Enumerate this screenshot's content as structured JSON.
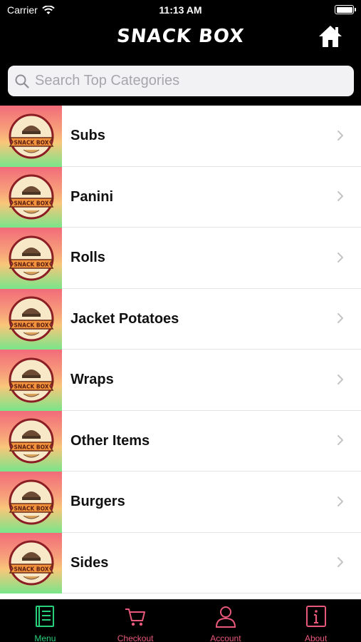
{
  "status": {
    "carrier": "Carrier",
    "time": "11:13 AM"
  },
  "header": {
    "title": "SNACK BOX",
    "home_icon": "home-icon"
  },
  "search": {
    "placeholder": "Search Top Categories",
    "value": ""
  },
  "categories": [
    {
      "label": "Subs",
      "logo_text": "SNACK BOX"
    },
    {
      "label": "Panini",
      "logo_text": "SNACK BOX"
    },
    {
      "label": "Rolls",
      "logo_text": "SNACK BOX"
    },
    {
      "label": "Jacket Potatoes",
      "logo_text": "SNACK BOX"
    },
    {
      "label": "Wraps",
      "logo_text": "SNACK BOX"
    },
    {
      "label": "Other Items",
      "logo_text": "SNACK BOX"
    },
    {
      "label": "Burgers",
      "logo_text": "SNACK BOX"
    },
    {
      "label": "Sides",
      "logo_text": "SNACK BOX"
    }
  ],
  "tabs": [
    {
      "label": "Menu",
      "icon": "menu-book-icon",
      "active": true
    },
    {
      "label": "Checkout",
      "icon": "cart-icon",
      "active": false
    },
    {
      "label": "Account",
      "icon": "person-icon",
      "active": false
    },
    {
      "label": "About",
      "icon": "info-icon",
      "active": false
    }
  ],
  "colors": {
    "active_tab": "#27d07a",
    "inactive_tab": "#e8587a",
    "background": "#000000"
  }
}
